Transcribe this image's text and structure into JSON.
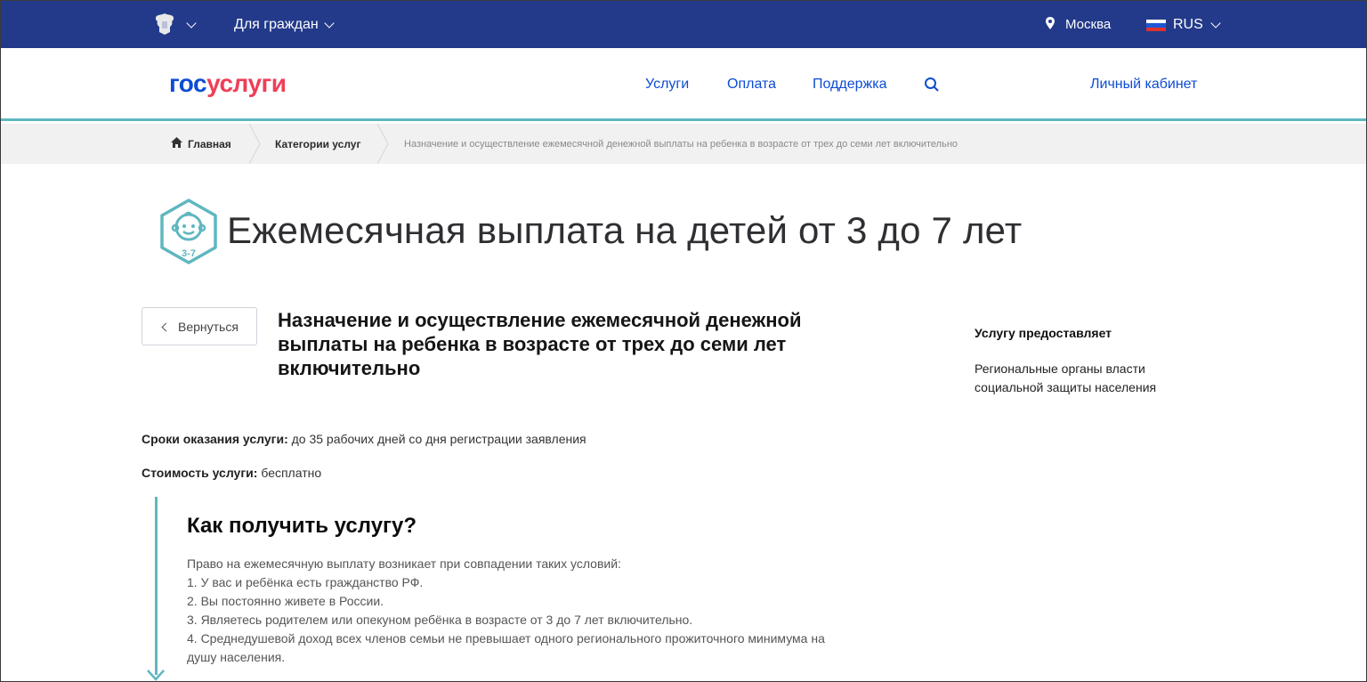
{
  "topbar": {
    "citizens_label": "Для граждан",
    "city_label": "Москва",
    "lang_label": "RUS"
  },
  "header": {
    "logo_part1": "гос",
    "logo_part2": "услуги",
    "nav": [
      "Услуги",
      "Оплата",
      "Поддержка"
    ],
    "cabinet_label": "Личный кабинет"
  },
  "breadcrumb": {
    "home": "Главная",
    "categories": "Категории услуг",
    "current": "Назначение и осуществление ежемесячной денежной выплаты на ребенка в возрасте от трех до семи лет включительно"
  },
  "page": {
    "title": "Ежемесячная выплата на детей от 3 до 7 лет",
    "icon_badge": "3-7",
    "back_label": "Вернуться",
    "subtitle": "Назначение и осуществление ежемесячной денежной выплаты на ребенка в возрасте от трех до семи лет включительно",
    "provider_title": "Услугу предоставляет",
    "provider_text": "Региональные органы власти социальной защиты населения",
    "terms_label": "Сроки оказания услуги:",
    "terms_value": " до 35 рабочих дней со дня регистрации заявления",
    "cost_label": "Стоимость услуги:",
    "cost_value": " бесплатно",
    "how_title": "Как получить услугу?",
    "how_intro": "Право на ежемесячную выплату возникает при совпадении таких условий:",
    "how_items": [
      "1. У вас и ребёнка есть гражданство РФ.",
      "2. Вы постоянно живете в России.",
      "3. Являетесь родителем или опекуном ребёнка в возрасте от 3 до 7 лет включительно.",
      "4. Среднедушевой доход всех членов семьи не превышает одного регионального прожиточного минимума на",
      "душу населения."
    ]
  },
  "colors": {
    "topbar": "#233a8a",
    "link": "#0d4cd3",
    "accent": "#5fb7c0",
    "logo_red": "#ee3f58"
  }
}
